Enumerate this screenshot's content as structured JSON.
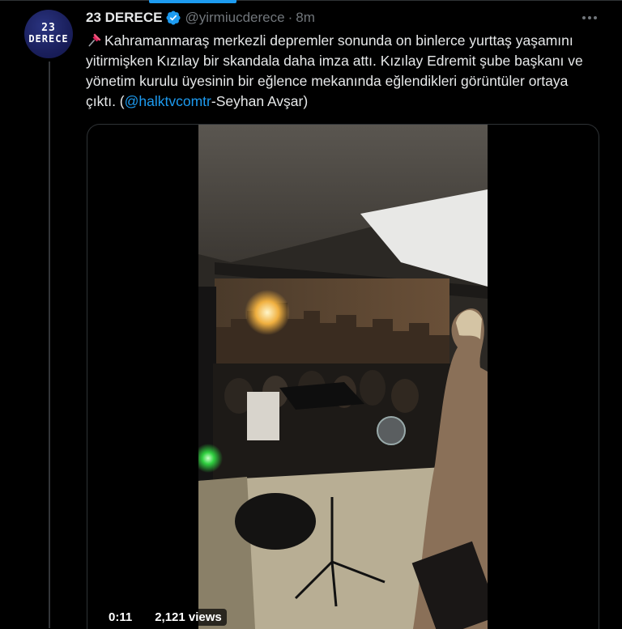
{
  "tweet": {
    "display_name": "23 DERECE",
    "handle": "@yirmiucderece",
    "separator": "·",
    "time": "8m",
    "avatar": {
      "line1": "23",
      "line2": "DERECE"
    },
    "text_part1": "Kahramanmaraş merkezli depremler sonunda on binlerce yurttaş yaşamını yitirmişken Kızılay bir skandala daha imza attı. Kızılay Edremit şube başkanı ve yönetim kurulu üyesinin bir eğlence mekanında eğlendikleri görüntüler ortaya çıktı. (",
    "mention": "@halktvcomtr",
    "text_part2": "-Seyhan Avşar)",
    "icons": {
      "pin": "pushpin-icon",
      "verified": "verified-badge-icon",
      "more": "more-options-icon"
    }
  },
  "video": {
    "elapsed": "0:11",
    "views": "2,121 views"
  },
  "colors": {
    "background": "#000000",
    "text": "#e7e9ea",
    "muted": "#71767b",
    "accent": "#1d9bf0",
    "border": "#2f3336"
  }
}
